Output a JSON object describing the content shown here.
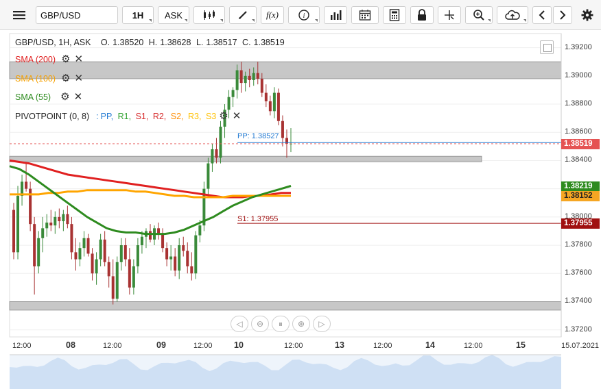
{
  "toolbar": {
    "symbol": "GBP/USD",
    "timeframe": "1H",
    "price_type": "ASK",
    "icons": [
      "menu-icon",
      "candlestick-icon",
      "draw-pen-icon",
      "function-icon",
      "info-icon",
      "bar-chart-icon",
      "calendar-icon",
      "calculator-icon",
      "lock-icon",
      "crosshair-icon",
      "zoom-icon",
      "cloud-upload-icon",
      "chevron-left-icon",
      "chevron-right-icon",
      "gear-icon"
    ],
    "function_label": "f(x)"
  },
  "header": {
    "instrument": "GBP/USD, 1H, ASK",
    "open_label": "O.",
    "open": "1.38520",
    "high_label": "H.",
    "high": "1.38628",
    "low_label": "L.",
    "low": "1.38517",
    "close_label": "C.",
    "close": "1.38519"
  },
  "legend": {
    "sma200": "SMA (200)",
    "sma100": "SMA (100)",
    "sma55": "SMA (55)",
    "pivot_name": "PIVOTPOINT (0, 8)",
    "pivot_sep": ":",
    "pivot_items": [
      {
        "label": "PP,",
        "color": "#1f78d1"
      },
      {
        "label": "R1,",
        "color": "#2ca02c"
      },
      {
        "label": "S1,",
        "color": "#d62728"
      },
      {
        "label": "R2,",
        "color": "#d62728"
      },
      {
        "label": "S2,",
        "color": "#ff8c00"
      },
      {
        "label": "R3,",
        "color": "#ffc000"
      },
      {
        "label": "S3",
        "color": "#ffc000"
      }
    ]
  },
  "annotations": {
    "pp": "PP: 1.38527",
    "s1": "S1: 1.37955"
  },
  "price_axis": [
    "1.39200",
    "1.39000",
    "1.38800",
    "1.38600",
    "1.38400",
    "1.38200",
    "1.38000",
    "1.37800",
    "1.37600",
    "1.37400",
    "1.37200"
  ],
  "price_tags": [
    {
      "label": "1.38519",
      "color": "#e55353"
    },
    {
      "label": "1.38219",
      "color": "#2e8b1f"
    },
    {
      "label": "1.38152",
      "color": "#f5a623",
      "text": "#222"
    },
    {
      "label": "1.37955",
      "color": "#a01010"
    }
  ],
  "time_axis": [
    {
      "label": "12:00",
      "bold": false
    },
    {
      "label": "08",
      "bold": true
    },
    {
      "label": "12:00",
      "bold": false
    },
    {
      "label": "09",
      "bold": true
    },
    {
      "label": "12:00",
      "bold": false
    },
    {
      "label": "10",
      "bold": true
    },
    {
      "label": "12:00",
      "bold": false
    },
    {
      "label": "13",
      "bold": true
    },
    {
      "label": "12:00",
      "bold": false
    },
    {
      "label": "14",
      "bold": true
    },
    {
      "label": "12:00",
      "bold": false
    },
    {
      "label": "15",
      "bold": true
    },
    {
      "label": "15.07.2021",
      "bold": false
    }
  ],
  "colors": {
    "sma200": "#e02020",
    "sma100": "#ffa500",
    "sma55": "#2e8b1f",
    "candle_up": "#3a8a3a",
    "candle_down": "#a83232",
    "zone": "#bdbdbd"
  },
  "chart_data": {
    "type": "candlestick",
    "y_range": [
      1.3715,
      1.393
    ],
    "bars_per_day": 24,
    "candles": [
      [
        1.3805,
        1.381,
        1.377,
        1.3775
      ],
      [
        1.3775,
        1.3822,
        1.377,
        1.3815
      ],
      [
        1.3815,
        1.383,
        1.3808,
        1.3825
      ],
      [
        1.3825,
        1.3838,
        1.3818,
        1.382
      ],
      [
        1.382,
        1.3825,
        1.379,
        1.3795
      ],
      [
        1.3795,
        1.38,
        1.3745,
        1.3765
      ],
      [
        1.3765,
        1.379,
        1.376,
        1.3785
      ],
      [
        1.3785,
        1.38,
        1.3775,
        1.3792
      ],
      [
        1.3792,
        1.3802,
        1.3786,
        1.3796
      ],
      [
        1.3796,
        1.3805,
        1.379,
        1.3794
      ],
      [
        1.3794,
        1.3804,
        1.3788,
        1.38
      ],
      [
        1.38,
        1.3806,
        1.3792,
        1.3797
      ],
      [
        1.3797,
        1.3805,
        1.379,
        1.3802
      ],
      [
        1.3802,
        1.3808,
        1.3792,
        1.3795
      ],
      [
        1.3795,
        1.38,
        1.377,
        1.3775
      ],
      [
        1.3775,
        1.3785,
        1.3762,
        1.377
      ],
      [
        1.377,
        1.3782,
        1.3765,
        1.3778
      ],
      [
        1.3778,
        1.379,
        1.3772,
        1.3785
      ],
      [
        1.3785,
        1.3788,
        1.3772,
        1.3774
      ],
      [
        1.3774,
        1.3778,
        1.3755,
        1.376
      ],
      [
        1.376,
        1.3775,
        1.3752,
        1.377
      ],
      [
        1.377,
        1.3788,
        1.3765,
        1.3784
      ],
      [
        1.3784,
        1.379,
        1.3765,
        1.3768
      ],
      [
        1.3768,
        1.3772,
        1.375,
        1.3758
      ],
      [
        1.3758,
        1.377,
        1.3738,
        1.3742
      ],
      [
        1.3742,
        1.3772,
        1.374,
        1.3768
      ],
      [
        1.3768,
        1.3785,
        1.3762,
        1.378
      ],
      [
        1.378,
        1.3785,
        1.3765,
        1.377
      ],
      [
        1.377,
        1.3778,
        1.3745,
        1.375
      ],
      [
        1.375,
        1.377,
        1.3745,
        1.3765
      ],
      [
        1.3765,
        1.3785,
        1.376,
        1.378
      ],
      [
        1.378,
        1.379,
        1.3774,
        1.3786
      ],
      [
        1.3786,
        1.3792,
        1.3778,
        1.379
      ],
      [
        1.379,
        1.3795,
        1.3782,
        1.3784
      ],
      [
        1.3784,
        1.3794,
        1.378,
        1.3792
      ],
      [
        1.3792,
        1.3796,
        1.3784,
        1.3788
      ],
      [
        1.3788,
        1.3792,
        1.3775,
        1.3778
      ],
      [
        1.3778,
        1.3782,
        1.3765,
        1.377
      ],
      [
        1.377,
        1.378,
        1.3762,
        1.3772
      ],
      [
        1.3772,
        1.3778,
        1.3758,
        1.3762
      ],
      [
        1.3762,
        1.3785,
        1.3756,
        1.378
      ],
      [
        1.378,
        1.3786,
        1.3772,
        1.3776
      ],
      [
        1.3776,
        1.3782,
        1.376,
        1.3765
      ],
      [
        1.3765,
        1.3775,
        1.3755,
        1.376
      ],
      [
        1.376,
        1.379,
        1.3756,
        1.3787
      ],
      [
        1.3787,
        1.3798,
        1.3782,
        1.3794
      ],
      [
        1.3794,
        1.3825,
        1.379,
        1.382
      ],
      [
        1.382,
        1.3842,
        1.3815,
        1.3838
      ],
      [
        1.3838,
        1.3852,
        1.3832,
        1.3848
      ],
      [
        1.3848,
        1.3856,
        1.3838,
        1.3842
      ],
      [
        1.3842,
        1.3868,
        1.3838,
        1.3864
      ],
      [
        1.3864,
        1.388,
        1.3856,
        1.3876
      ],
      [
        1.3876,
        1.389,
        1.387,
        1.3885
      ],
      [
        1.3885,
        1.3892,
        1.3878,
        1.389
      ],
      [
        1.389,
        1.3908,
        1.3884,
        1.3904
      ],
      [
        1.3904,
        1.391,
        1.3888,
        1.3895
      ],
      [
        1.3895,
        1.3903,
        1.3889,
        1.39
      ],
      [
        1.39,
        1.3905,
        1.3892,
        1.3897
      ],
      [
        1.3897,
        1.3906,
        1.3893,
        1.3902
      ],
      [
        1.3902,
        1.391,
        1.3894,
        1.3898
      ],
      [
        1.3898,
        1.3902,
        1.3885,
        1.3888
      ],
      [
        1.3888,
        1.3894,
        1.3878,
        1.3882
      ],
      [
        1.3882,
        1.3886,
        1.3872,
        1.3875
      ],
      [
        1.3875,
        1.3892,
        1.387,
        1.3888
      ],
      [
        1.3888,
        1.3891,
        1.3865,
        1.3868
      ],
      [
        1.3868,
        1.3872,
        1.385,
        1.3856
      ],
      [
        1.3856,
        1.3862,
        1.3842,
        1.3852
      ],
      [
        1.3852,
        1.3863,
        1.3846,
        1.3852
      ]
    ],
    "sma200": [
      1.384,
      1.3839,
      1.3838,
      1.3836,
      1.3834,
      1.3832,
      1.383,
      1.3829,
      1.3828,
      1.3827,
      1.3826,
      1.3825,
      1.3824,
      1.3823,
      1.3822,
      1.3821,
      1.382,
      1.3819,
      1.3818,
      1.3817,
      1.3816,
      1.3815,
      1.3814,
      1.3814,
      1.3814,
      1.3815,
      1.3815,
      1.3816,
      1.3817,
      1.3817
    ],
    "sma100": [
      1.3816,
      1.3816,
      1.3816,
      1.3816,
      1.3817,
      1.3817,
      1.3818,
      1.3818,
      1.3819,
      1.3819,
      1.3819,
      1.3819,
      1.3819,
      1.3818,
      1.3818,
      1.3817,
      1.3816,
      1.3815,
      1.3815,
      1.3814,
      1.3814,
      1.3814,
      1.3814,
      1.3815,
      1.3815,
      1.3815,
      1.3815,
      1.3815,
      1.3815,
      1.3815
    ],
    "sma55": [
      1.3836,
      1.3834,
      1.383,
      1.3825,
      1.382,
      1.3815,
      1.381,
      1.3805,
      1.38,
      1.3796,
      1.3792,
      1.379,
      1.3789,
      1.3789,
      1.3788,
      1.3788,
      1.3788,
      1.3789,
      1.3791,
      1.3794,
      1.3797,
      1.38,
      1.3804,
      1.3808,
      1.3811,
      1.3814,
      1.3816,
      1.3818,
      1.382,
      1.3822
    ],
    "zones": [
      {
        "from": 1.3898,
        "to": 1.391
      },
      {
        "from": 1.3842,
        "to": 1.3843
      },
      {
        "from": 1.3734,
        "to": 1.374
      }
    ],
    "pp": 1.38527,
    "s1": 1.37955,
    "last": 1.38519
  }
}
